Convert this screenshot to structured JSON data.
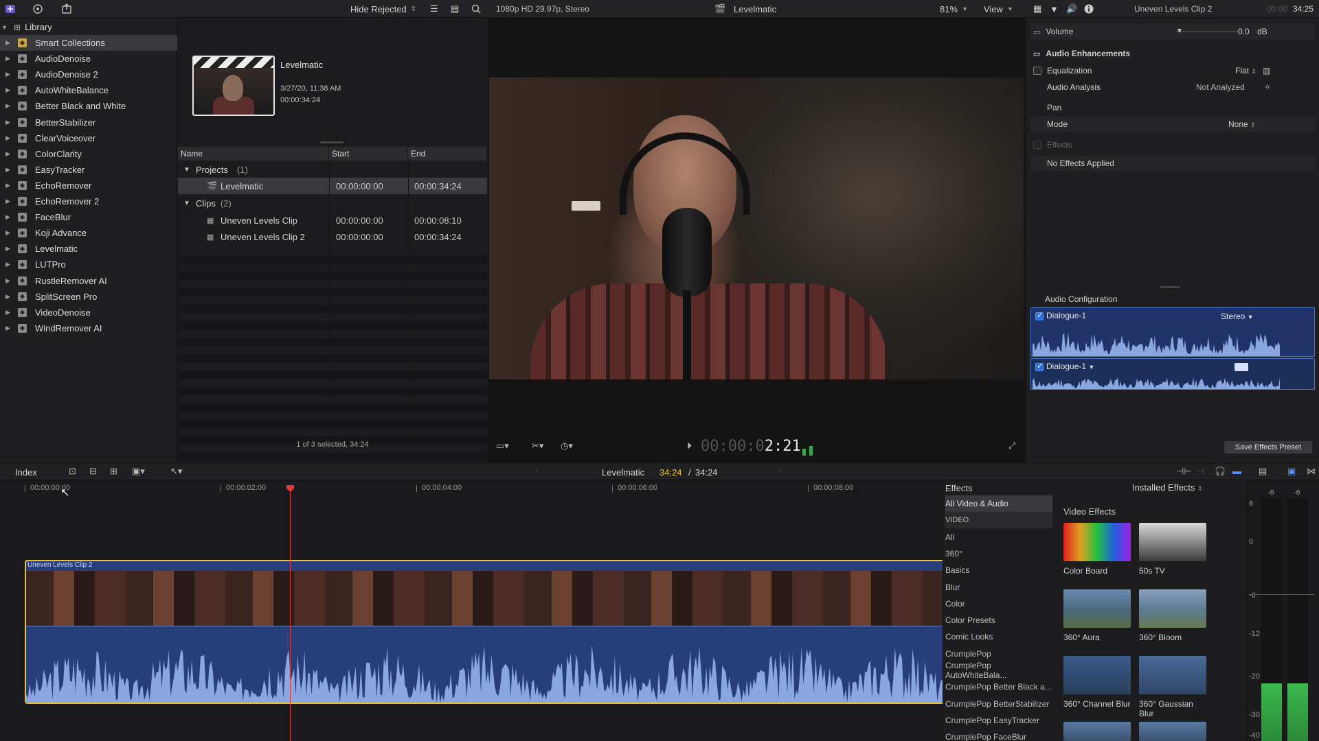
{
  "topbar": {
    "hide_rejected": "Hide Rejected",
    "format": "1080p HD 29.97p, Stereo",
    "viewer_title": "Levelmatic",
    "zoom": "81%",
    "view": "View",
    "inspector_clip": "Uneven Levels Clip 2",
    "inspector_duration_dim": "00:00",
    "inspector_duration": "34:25"
  },
  "library": {
    "name": "Library",
    "items": [
      "Smart Collections",
      "AudioDenoise",
      "AudioDenoise 2",
      "AutoWhiteBalance",
      "Better Black and White",
      "BetterStabilizer",
      "ClearVoiceover",
      "ColorClarity",
      "EasyTracker",
      "EchoRemover",
      "EchoRemover 2",
      "FaceBlur",
      "Koji Advance",
      "Levelmatic",
      "LUTPro",
      "RustleRemover AI",
      "SplitScreen Pro",
      "VideoDenoise",
      "WindRemover AI"
    ]
  },
  "browser": {
    "project_name": "Levelmatic",
    "project_date": "3/27/20, 11:38 AM",
    "project_duration": "00:00:34:24",
    "columns": {
      "name": "Name",
      "start": "Start",
      "end": "End"
    },
    "groups": [
      {
        "label": "Projects",
        "count": "(1)"
      },
      {
        "label": "Clips",
        "count": "(2)"
      }
    ],
    "rows": [
      {
        "name": "Levelmatic",
        "start": "00:00:00:00",
        "end": "00:00:34:24"
      },
      {
        "name": "Uneven Levels Clip",
        "start": "00:00:00:00",
        "end": "00:00:08:10"
      },
      {
        "name": "Uneven Levels Clip 2",
        "start": "00:00:00:00",
        "end": "00:00:34:24"
      }
    ],
    "status": "1 of 3 selected, 34:24"
  },
  "viewer": {
    "timecode_dim": "00:00:0",
    "timecode": "2:21"
  },
  "inspector": {
    "volume_label": "Volume",
    "volume_value": "0.0",
    "volume_unit": "dB",
    "enhancements": "Audio Enhancements",
    "equalization": "Equalization",
    "equalization_value": "Flat",
    "analysis": "Audio Analysis",
    "analysis_value": "Not Analyzed",
    "pan": "Pan",
    "mode": "Mode",
    "mode_value": "None",
    "effects": "Effects",
    "no_effects": "No Effects Applied",
    "audio_config": "Audio Configuration",
    "dialogue1": "Dialogue-1",
    "stereo": "Stereo",
    "dialogue2": "Dialogue-1",
    "save_preset": "Save Effects Preset"
  },
  "midbar": {
    "index": "Index",
    "project": "Levelmatic",
    "position": "34:24",
    "separator": "/",
    "total": "34:24"
  },
  "timeline": {
    "ruler": [
      "00:00:00:00",
      "00:00:02:00",
      "00:00:04:00",
      "00:00:06:00",
      "00:00:08:00"
    ],
    "clip_name": "Uneven Levels Clip 2"
  },
  "effects": {
    "title": "Effects",
    "installed": "Installed Effects",
    "section": "Video Effects",
    "categories": [
      "All Video & Audio",
      "VIDEO",
      "All",
      "360°",
      "Basics",
      "Blur",
      "Color",
      "Color Presets",
      "Comic Looks",
      "CrumplePop",
      "CrumplePop AutoWhiteBala...",
      "CrumplePop Better Black a...",
      "CrumplePop BetterStabilizer",
      "CrumplePop EasyTracker",
      "CrumplePop FaceBlur"
    ],
    "items": [
      "Color Board",
      "50s TV",
      "360° Aura",
      "360° Bloom",
      "360° Channel Blur",
      "360° Gaussian Blur"
    ]
  },
  "meters": {
    "labels": [
      "-6",
      "-6",
      "6",
      "0",
      "-6",
      "-12",
      "-20",
      "-30",
      "-40"
    ]
  }
}
